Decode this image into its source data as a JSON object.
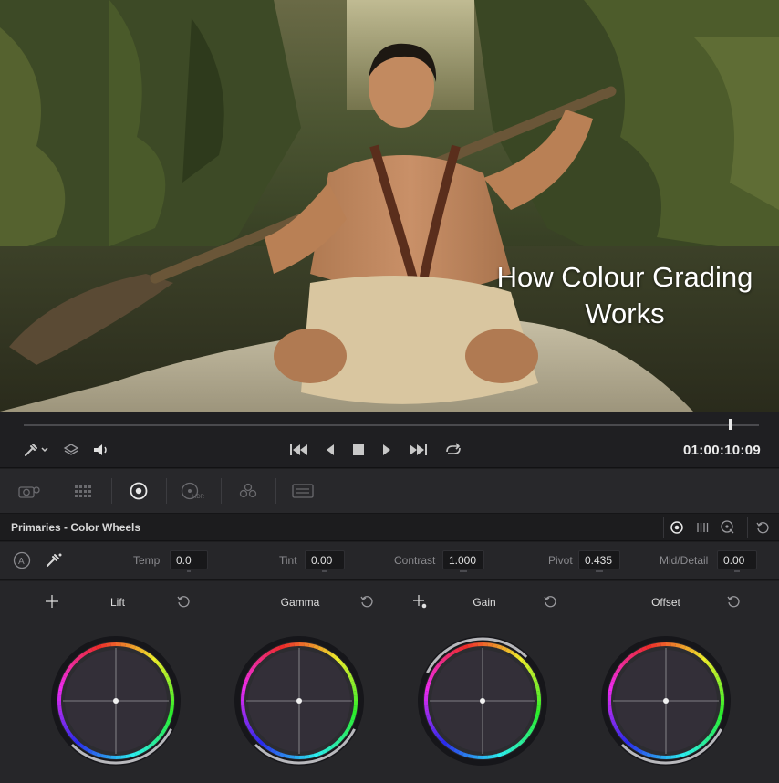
{
  "viewer": {
    "overlay_title": "How Colour Grading Works"
  },
  "transport": {
    "timecode": "01:00:10:09",
    "playhead_fraction": 0.96
  },
  "palette": {
    "items": [
      "camera-raw-icon",
      "color-match-icon",
      "color-wheels-icon",
      "hdr-wheels-icon",
      "rgb-mixer-icon",
      "motion-effects-icon"
    ],
    "active": "color-wheels-icon"
  },
  "panel": {
    "title": "Primaries - Color Wheels",
    "modes": [
      "wheels-mode-icon",
      "bars-mode-icon",
      "log-mode-icon"
    ],
    "reset_label": "reset-all-icon"
  },
  "params": {
    "temp": {
      "label": "Temp",
      "value": "0.0"
    },
    "tint": {
      "label": "Tint",
      "value": "0.00"
    },
    "contrast": {
      "label": "Contrast",
      "value": "1.000"
    },
    "pivot": {
      "label": "Pivot",
      "value": "0.435"
    },
    "mid_detail": {
      "label": "Mid/Detail",
      "value": "0.00"
    }
  },
  "wheels": [
    {
      "label": "Lift"
    },
    {
      "label": "Gamma"
    },
    {
      "label": "Gain"
    },
    {
      "label": "Offset"
    }
  ],
  "colors": {
    "panel_bg": "#262629",
    "wheel_ring": "#8a8a8e",
    "accent": "#e8e8e8"
  }
}
